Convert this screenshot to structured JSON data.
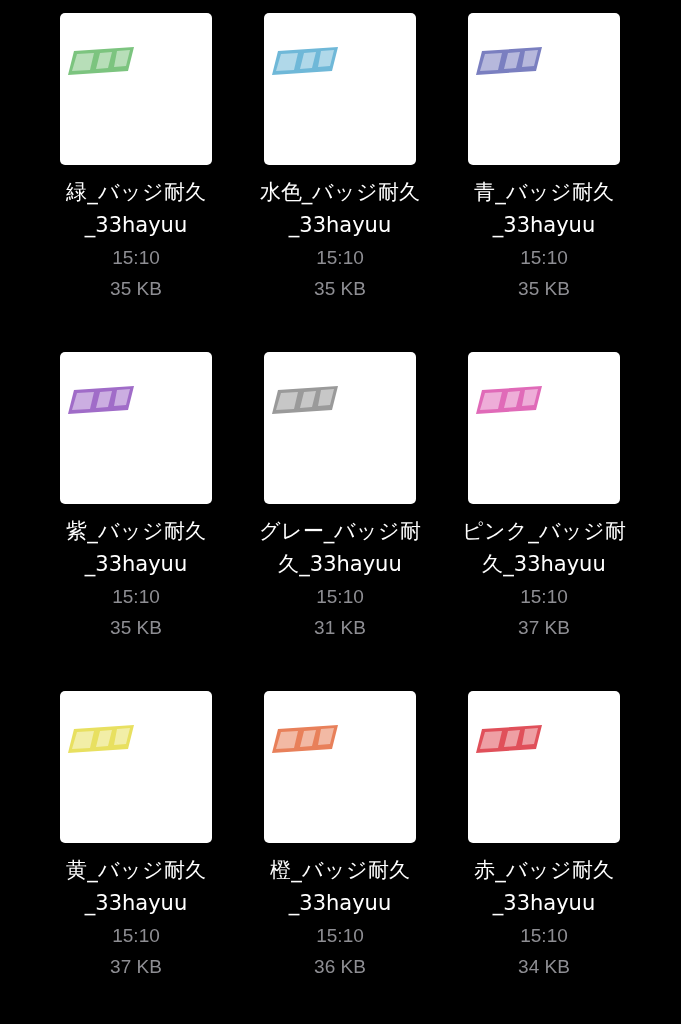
{
  "files": [
    {
      "name": "緑_バッジ耐久_33hayuu",
      "time": "15:10",
      "size": "35 KB",
      "color": "#7cc47f"
    },
    {
      "name": "水色_バッジ耐久_33hayuu",
      "time": "15:10",
      "size": "35 KB",
      "color": "#6fb8d8"
    },
    {
      "name": "青_バッジ耐久_33hayuu",
      "time": "15:10",
      "size": "35 KB",
      "color": "#7a7fc0"
    },
    {
      "name": "紫_バッジ耐久_33hayuu",
      "time": "15:10",
      "size": "35 KB",
      "color": "#a06cc8"
    },
    {
      "name": "グレー_バッジ耐久_33hayuu",
      "time": "15:10",
      "size": "31 KB",
      "color": "#9a9a9a"
    },
    {
      "name": "ピンク_バッジ耐久_33hayuu",
      "time": "15:10",
      "size": "37 KB",
      "color": "#e06ab8"
    },
    {
      "name": "黄_バッジ耐久_33hayuu",
      "time": "15:10",
      "size": "37 KB",
      "color": "#e8e060"
    },
    {
      "name": "橙_バッジ耐久_33hayuu",
      "time": "15:10",
      "size": "36 KB",
      "color": "#e8805a"
    },
    {
      "name": "赤_バッジ耐久_33hayuu",
      "time": "15:10",
      "size": "34 KB",
      "color": "#e0505a"
    }
  ]
}
